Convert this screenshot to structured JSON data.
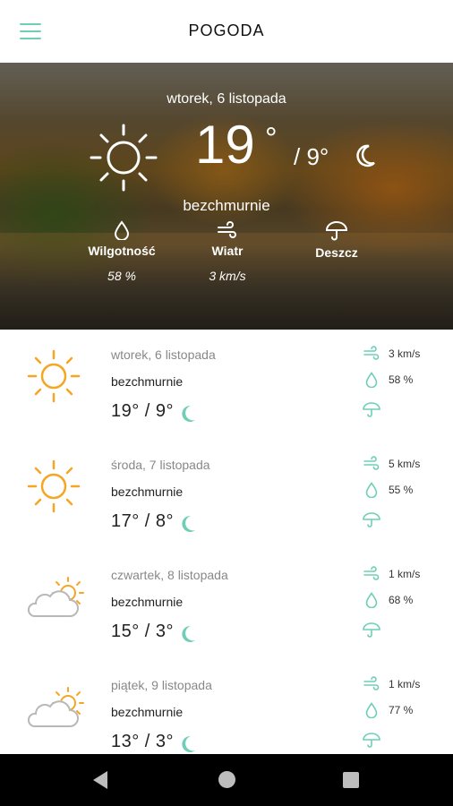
{
  "app": {
    "title": "POGODA",
    "accent": "#6fcfb6",
    "sun_color": "#f5a623"
  },
  "hero": {
    "date": "wtorek, 6 listopada",
    "temp": "19",
    "deg": "°",
    "min_temp": "/ 9°",
    "condition": "bezchmurnie",
    "stats": [
      {
        "icon": "drop-icon",
        "label": "Wilgotność",
        "value": "58 %"
      },
      {
        "icon": "wind-icon",
        "label": "Wiatr",
        "value": "3 km/s"
      },
      {
        "icon": "umbrella-icon",
        "label": "Deszcz",
        "value": ""
      }
    ]
  },
  "forecast": [
    {
      "date": "wtorek, 6 listopada",
      "condition": "bezchmurnie",
      "temps": "19°  /  9°",
      "wind": "3 km/s",
      "humidity": "58 %",
      "icon": "sun-icon"
    },
    {
      "date": "środa, 7 listopada",
      "condition": "bezchmurnie",
      "temps": "17°  /  8°",
      "wind": "5 km/s",
      "humidity": "55 %",
      "icon": "sun-icon"
    },
    {
      "date": "czwartek, 8 listopada",
      "condition": "bezchmurnie",
      "temps": "15°  /  3°",
      "wind": "1 km/s",
      "humidity": "68 %",
      "icon": "cloud-sun-icon"
    },
    {
      "date": "piątek, 9 listopada",
      "condition": "bezchmurnie",
      "temps": "13°  /  3°",
      "wind": "1 km/s",
      "humidity": "77 %",
      "icon": "cloud-sun-icon"
    }
  ],
  "navbar": {
    "back": "back-icon",
    "home": "home-icon",
    "recent": "recent-apps-icon"
  }
}
